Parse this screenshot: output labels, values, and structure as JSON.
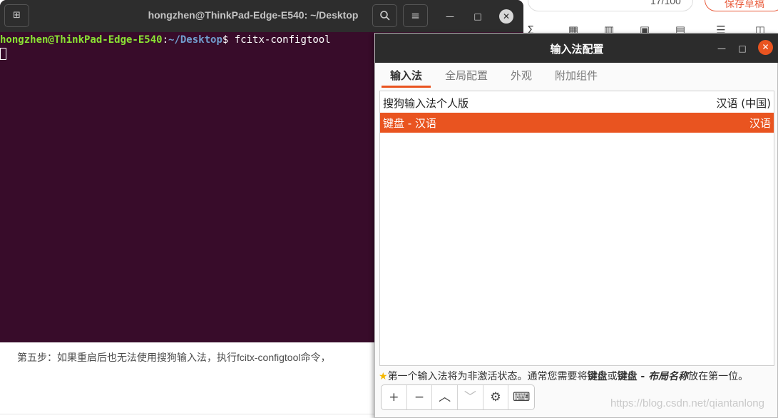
{
  "terminal": {
    "title": "hongzhen@ThinkPad-Edge-E540: ~/Desktop",
    "prompt_user": "hongzhen@ThinkPad-Edge-E540",
    "prompt_sep": ":",
    "prompt_path": "~/Desktop",
    "prompt_symbol": "$",
    "command": " fcitx-configtool"
  },
  "dialog": {
    "title": "输入法配置",
    "tabs": [
      {
        "label": "输入法",
        "active": true
      },
      {
        "label": "全局配置",
        "active": false
      },
      {
        "label": "外观",
        "active": false
      },
      {
        "label": "附加组件",
        "active": false
      }
    ],
    "rows": [
      {
        "name": "搜狗输入法个人版",
        "lang": "汉语 (中国)",
        "selected": false
      },
      {
        "name": "键盘 - 汉语",
        "lang": "汉语",
        "selected": true
      }
    ],
    "hint": {
      "prefix": "第一个输入法将为非激活状态。通常您需要将",
      "bold1": "键盘",
      "mid": "或",
      "bold2": "键盘 - ",
      "bold_italic": "布局名称",
      "suffix": "放在第一位。"
    }
  },
  "web": {
    "counter": "17/100",
    "save_label": "保存草稿",
    "step_text": "第五步：如果重启后也无法使用搜狗输入法，执行fcitx-configtool命令，",
    "watermark": "https://blog.csdn.net/qiantanlong"
  },
  "icons": {
    "accent": "#e95420",
    "terminal_bg": "#380c2a"
  }
}
